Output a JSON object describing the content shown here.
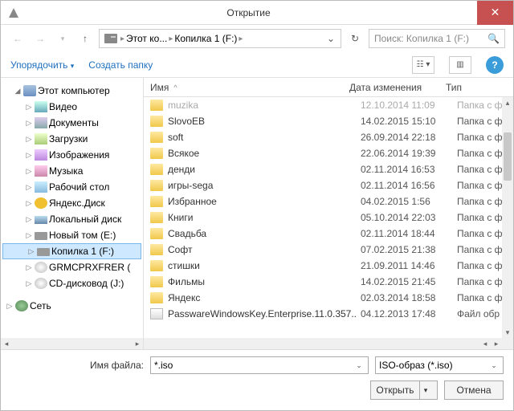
{
  "window": {
    "title": "Открытие"
  },
  "nav": {
    "breadcrumb": [
      "Этот ко...",
      "Копилка 1 (F:)"
    ],
    "search_placeholder": "Поиск: Копилка 1 (F:)"
  },
  "toolbar": {
    "organize": "Упорядочить",
    "new_folder": "Создать папку"
  },
  "tree": {
    "root": "Этот компьютер",
    "items": [
      {
        "label": "Видео",
        "icon": "ico-vid"
      },
      {
        "label": "Документы",
        "icon": "ico-doc"
      },
      {
        "label": "Загрузки",
        "icon": "ico-dl"
      },
      {
        "label": "Изображения",
        "icon": "ico-img"
      },
      {
        "label": "Музыка",
        "icon": "ico-mus"
      },
      {
        "label": "Рабочий стол",
        "icon": "ico-desk"
      },
      {
        "label": "Яндекс.Диск",
        "icon": "ico-yd"
      },
      {
        "label": "Локальный диск",
        "icon": "ico-ld"
      },
      {
        "label": "Новый том (E:)",
        "icon": "ico-drive"
      },
      {
        "label": "Копилка 1 (F:)",
        "icon": "ico-drive",
        "selected": true
      },
      {
        "label": "GRMCPRXFRER (",
        "icon": "ico-cd"
      },
      {
        "label": "CD-дисковод (J:)",
        "icon": "ico-cd"
      }
    ],
    "network": "Сеть"
  },
  "columns": {
    "name": "Имя",
    "date": "Дата изменения",
    "type": "Тип"
  },
  "files": [
    {
      "name": "muzika",
      "date": "12.10.2014 11:09",
      "type": "Папка с ф",
      "dim": true,
      "icon": "ico-folder"
    },
    {
      "name": "SlovoEB",
      "date": "14.02.2015 15:10",
      "type": "Папка с ф",
      "icon": "ico-folder"
    },
    {
      "name": "soft",
      "date": "26.09.2014 22:18",
      "type": "Папка с ф",
      "icon": "ico-folder"
    },
    {
      "name": "Всякое",
      "date": "22.06.2014 19:39",
      "type": "Папка с ф",
      "icon": "ico-folder"
    },
    {
      "name": "денди",
      "date": "02.11.2014 16:53",
      "type": "Папка с ф",
      "icon": "ico-folder"
    },
    {
      "name": "игры-sega",
      "date": "02.11.2014 16:56",
      "type": "Папка с ф",
      "icon": "ico-folder"
    },
    {
      "name": "Избранное",
      "date": "04.02.2015 1:56",
      "type": "Папка с ф",
      "icon": "ico-folder"
    },
    {
      "name": "Книги",
      "date": "05.10.2014 22:03",
      "type": "Папка с ф",
      "icon": "ico-folder"
    },
    {
      "name": "Свадьба",
      "date": "02.11.2014 18:44",
      "type": "Папка с ф",
      "icon": "ico-folder"
    },
    {
      "name": "Софт",
      "date": "07.02.2015 21:38",
      "type": "Папка с ф",
      "icon": "ico-folder"
    },
    {
      "name": "стишки",
      "date": "21.09.2011 14:46",
      "type": "Папка с ф",
      "icon": "ico-folder"
    },
    {
      "name": "Фильмы",
      "date": "14.02.2015 21:45",
      "type": "Папка с ф",
      "icon": "ico-folder"
    },
    {
      "name": "Яндекс",
      "date": "02.03.2014 18:58",
      "type": "Папка с ф",
      "icon": "ico-folder"
    },
    {
      "name": "PasswareWindowsKey.Enterprise.11.0.357..",
      "date": "04.12.2013 17:48",
      "type": "Файл обр",
      "icon": "ico-file"
    }
  ],
  "footer": {
    "filename_label": "Имя файла:",
    "filename_value": "*.iso",
    "filter_value": "ISO-образ (*.iso)",
    "open": "Открыть",
    "cancel": "Отмена"
  }
}
